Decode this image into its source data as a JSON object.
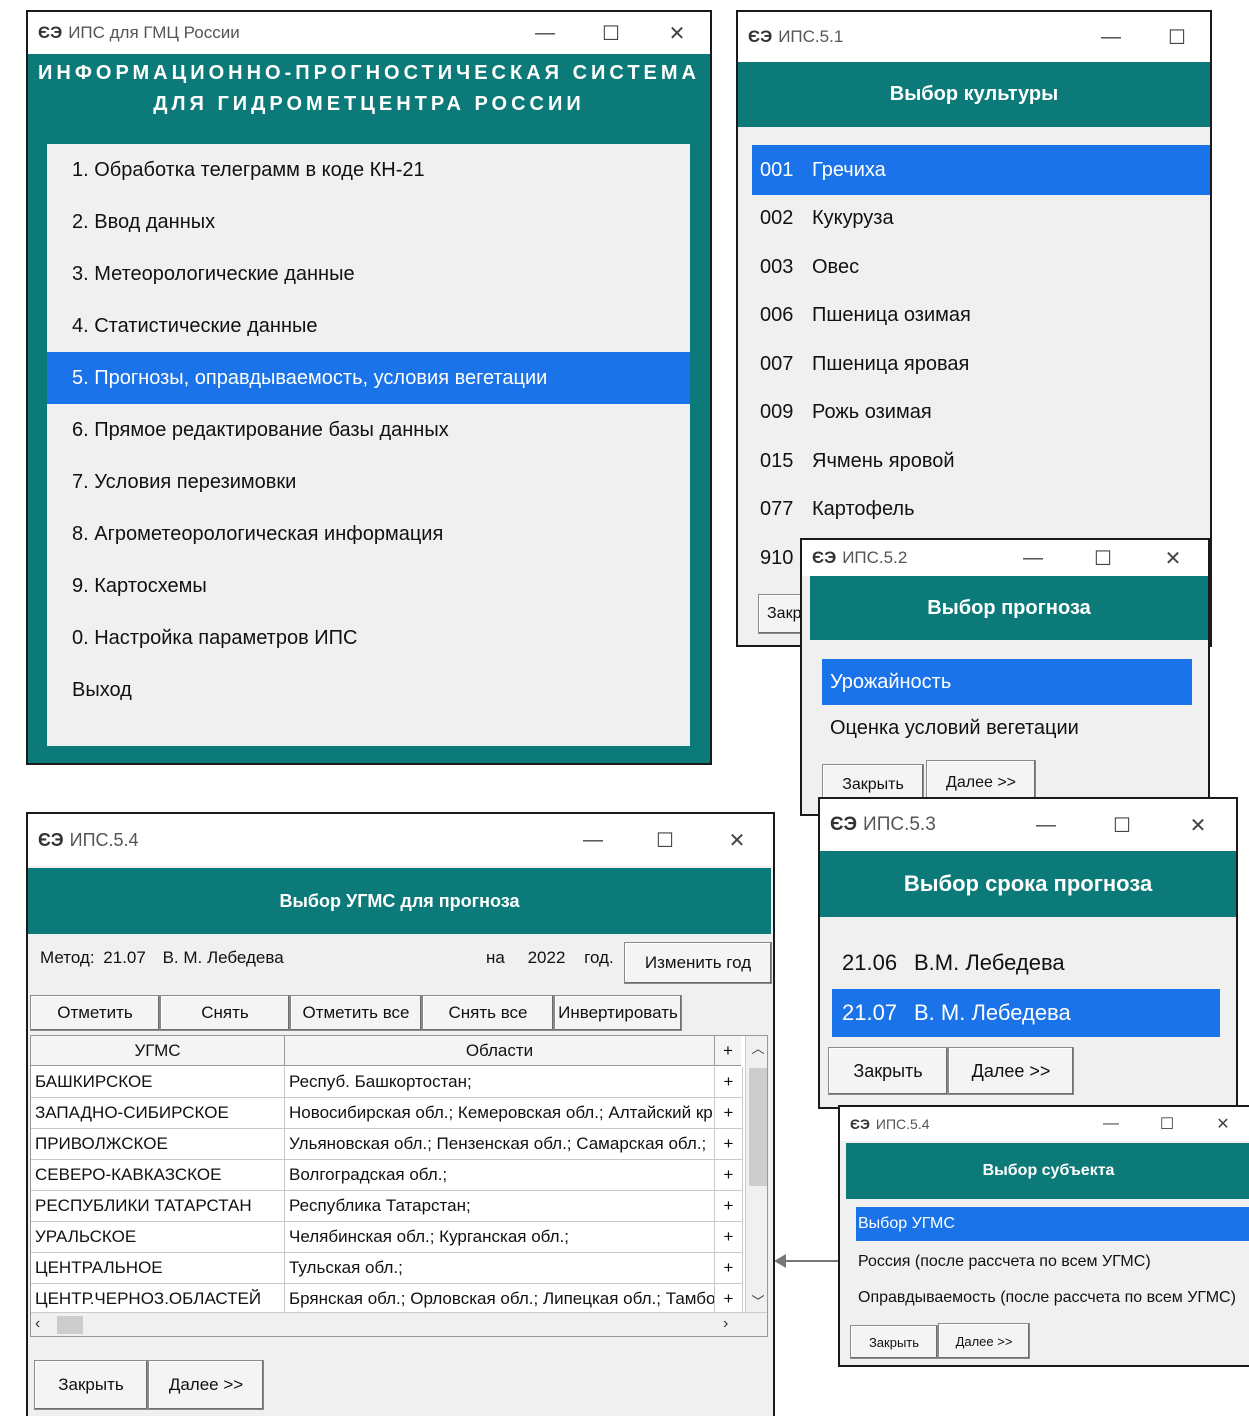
{
  "main_window": {
    "title": "ИПС для ГМЦ России",
    "header_line1": "ИНФОРМАЦИОННО-ПРОГНОСТИЧЕСКАЯ СИСТЕМА",
    "header_line2": "ДЛЯ ГИДРОМЕТЦЕНТРА РОССИИ",
    "menu": [
      "1. Обработка телеграмм в коде КН-21",
      "2. Ввод данных",
      "3. Метеорологические данные",
      "4. Статистические данные",
      "5. Прогнозы, оправдываемость, условия вегетации",
      "6. Прямое редактирование базы данных",
      "7. Условия перезимовки",
      "8. Агрометеорологическая информация",
      "9. Картосхемы",
      "0. Настройка параметров ИПС",
      "Выход"
    ],
    "selected_index": 4
  },
  "culture_window": {
    "title": "ИПС.5.1",
    "header": "Выбор культуры",
    "items": [
      {
        "code": "001",
        "name": "Гречиха"
      },
      {
        "code": "002",
        "name": "Кукуруза"
      },
      {
        "code": "003",
        "name": "Овес"
      },
      {
        "code": "006",
        "name": "Пшеница озимая"
      },
      {
        "code": "007",
        "name": "Пшеница яровая"
      },
      {
        "code": "009",
        "name": "Рожь озимая"
      },
      {
        "code": "015",
        "name": "Ячмень яровой"
      },
      {
        "code": "077",
        "name": "Картофель"
      },
      {
        "code": "910",
        "name": ""
      }
    ],
    "close_label_partial": "Закр"
  },
  "forecast_window": {
    "title": "ИПС.5.2",
    "header": "Выбор прогноза",
    "items": [
      "Урожайность",
      "Оценка условий вегетации"
    ],
    "close_label": "Закрыть",
    "next_label": "Далее >>"
  },
  "term_window": {
    "title": "ИПС.5.3",
    "header": "Выбор срока прогноза",
    "items": [
      {
        "code": "21.06",
        "name": "В.М. Лебедева"
      },
      {
        "code": "21.07",
        "name": "В. М. Лебедева"
      }
    ],
    "close_label": "Закрыть",
    "next_label": "Далее >>"
  },
  "subject_window": {
    "title": "ИПС.5.4",
    "header": "Выбор субъекта",
    "items": [
      "Выбор УГМС",
      "Россия (после рассчета по всем УГМС)",
      "Оправдываемость (после рассчета по всем УГМС)"
    ],
    "close_label": "Закрыть",
    "next_label": "Далее >>"
  },
  "ugms_window": {
    "title": "ИПС.5.4",
    "header": "Выбор УГМС для прогноза",
    "method_label": "Метод:",
    "method_code": "21.07",
    "method_author": "В. М. Лебедева",
    "on_label": "на",
    "year": "2022",
    "year_label": "год.",
    "change_year": "Изменить год",
    "toolbar": [
      "Отметить",
      "Снять",
      "Отметить все",
      "Снять все",
      "Инвертировать"
    ],
    "columns": {
      "ugms": "УГМС",
      "regions": "Области",
      "mark": "+"
    },
    "rows": [
      {
        "ugms": "БАШКИРСКОЕ",
        "regions": "Респуб. Башкортостан;",
        "mark": "+"
      },
      {
        "ugms": "ЗАПАДНО-СИБИРСКОЕ",
        "regions": "Новосибирская обл.; Кемеровская обл.; Алтайский кр",
        "mark": "+"
      },
      {
        "ugms": "ПРИВОЛЖСКОЕ",
        "regions": "Ульяновская обл.; Пензенская обл.; Самарская обл.;",
        "mark": "+"
      },
      {
        "ugms": "СЕВЕРО-КАВКАЗСКОЕ",
        "regions": "Волгоградская обл.;",
        "mark": "+"
      },
      {
        "ugms": "РЕСПУБЛИКИ ТАТАРСТАН",
        "regions": "Республика Татарстан;",
        "mark": "+"
      },
      {
        "ugms": "УРАЛЬСКОЕ",
        "regions": "Челябинская обл.; Курганская обл.;",
        "mark": "+"
      },
      {
        "ugms": "ЦЕНТРАЛЬНОЕ",
        "regions": "Тульская обл.;",
        "mark": "+"
      },
      {
        "ugms": "ЦЕНТР.ЧЕРНОЗ.ОБЛАСТЕЙ",
        "regions": "Брянская обл.; Орловская обл.; Липецкая обл.; Тамбо",
        "mark": "+"
      }
    ],
    "close_label": "Закрыть",
    "next_label": "Далее >>"
  },
  "controls": {
    "minimize": "—",
    "maximize": "☐",
    "close": "✕",
    "app_icon": "ЄЭ"
  }
}
